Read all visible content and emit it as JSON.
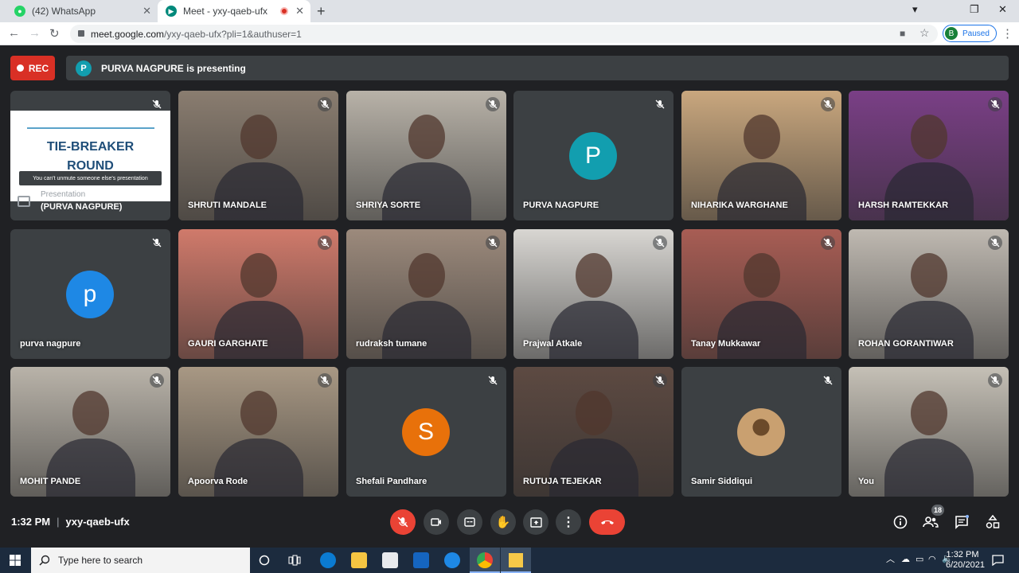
{
  "browser": {
    "tabs": [
      {
        "label": "(42) WhatsApp",
        "icon": "whatsapp-icon",
        "close": "✕"
      },
      {
        "label": "Meet - yxy-qaeb-ufx",
        "icon": "meet-icon",
        "close": "✕"
      }
    ],
    "new_tab": "+",
    "url_host": "meet.google.com",
    "url_path": "/yxy-qaeb-ufx?pli=1&authuser=1",
    "profile_initial": "B",
    "profile_status": "Paused",
    "window_controls": [
      "▾",
      "❐",
      "✕"
    ]
  },
  "meet": {
    "rec_label": "REC",
    "presenter_initial": "P",
    "presenting_text": "PURVA NAGPURE is presenting",
    "presentation_tile": {
      "slide_title_1": "TIE-BREAKER",
      "slide_title_2": "ROUND",
      "tooltip": "You can't unmute someone else's presentation",
      "sub_label": "Presentation",
      "name": "(PURVA NAGPURE)"
    },
    "participants": [
      {
        "name": "SHRUTI MANDALE",
        "type": "video",
        "bg": "#8a7d70"
      },
      {
        "name": "SHRIYA SORTE",
        "type": "video",
        "bg": "#b8b2a8"
      },
      {
        "name": "PURVA NAGPURE",
        "type": "avatar",
        "initial": "P",
        "color": "#129eaf"
      },
      {
        "name": "NIHARIKA WARGHANE",
        "type": "video",
        "bg": "#c9a77e"
      },
      {
        "name": "HARSH RAMTEKKAR",
        "type": "video",
        "bg": "#7a3f86"
      },
      {
        "name": "purva nagpure",
        "type": "avatar",
        "initial": "p",
        "color": "#1e88e5"
      },
      {
        "name": "GAURI GARGHATE",
        "type": "video",
        "bg": "#d07a6b"
      },
      {
        "name": "rudraksh tumane",
        "type": "video",
        "bg": "#9c8a7c"
      },
      {
        "name": "Prajwal Atkale",
        "type": "video",
        "bg": "#d8d6d2"
      },
      {
        "name": "Tanay Mukkawar",
        "type": "video",
        "bg": "#a85d54"
      },
      {
        "name": "ROHAN GORANTIWAR",
        "type": "video",
        "bg": "#bfb9b1"
      },
      {
        "name": "MOHIT PANDE",
        "type": "video",
        "bg": "#b9b3a9"
      },
      {
        "name": "Apoorva Rode",
        "type": "video",
        "bg": "#a89884"
      },
      {
        "name": "Shefali Pandhare",
        "type": "avatar",
        "initial": "S",
        "color": "#e8710a"
      },
      {
        "name": "RUTUJA TEJEKAR",
        "type": "video",
        "bg": "#5d4a42"
      },
      {
        "name": "Samir Siddiqui",
        "type": "photo-avatar",
        "color": "#c9a070"
      },
      {
        "name": "You",
        "type": "video",
        "bg": "#c5c0b6"
      }
    ],
    "bottom": {
      "time": "1:32 PM",
      "separator": "|",
      "meeting_code": "yxy-qaeb-ufx",
      "participant_count": "18"
    }
  },
  "taskbar": {
    "search_placeholder": "Type here to search",
    "clock_time": "1:32 PM",
    "clock_date": "6/20/2021"
  }
}
